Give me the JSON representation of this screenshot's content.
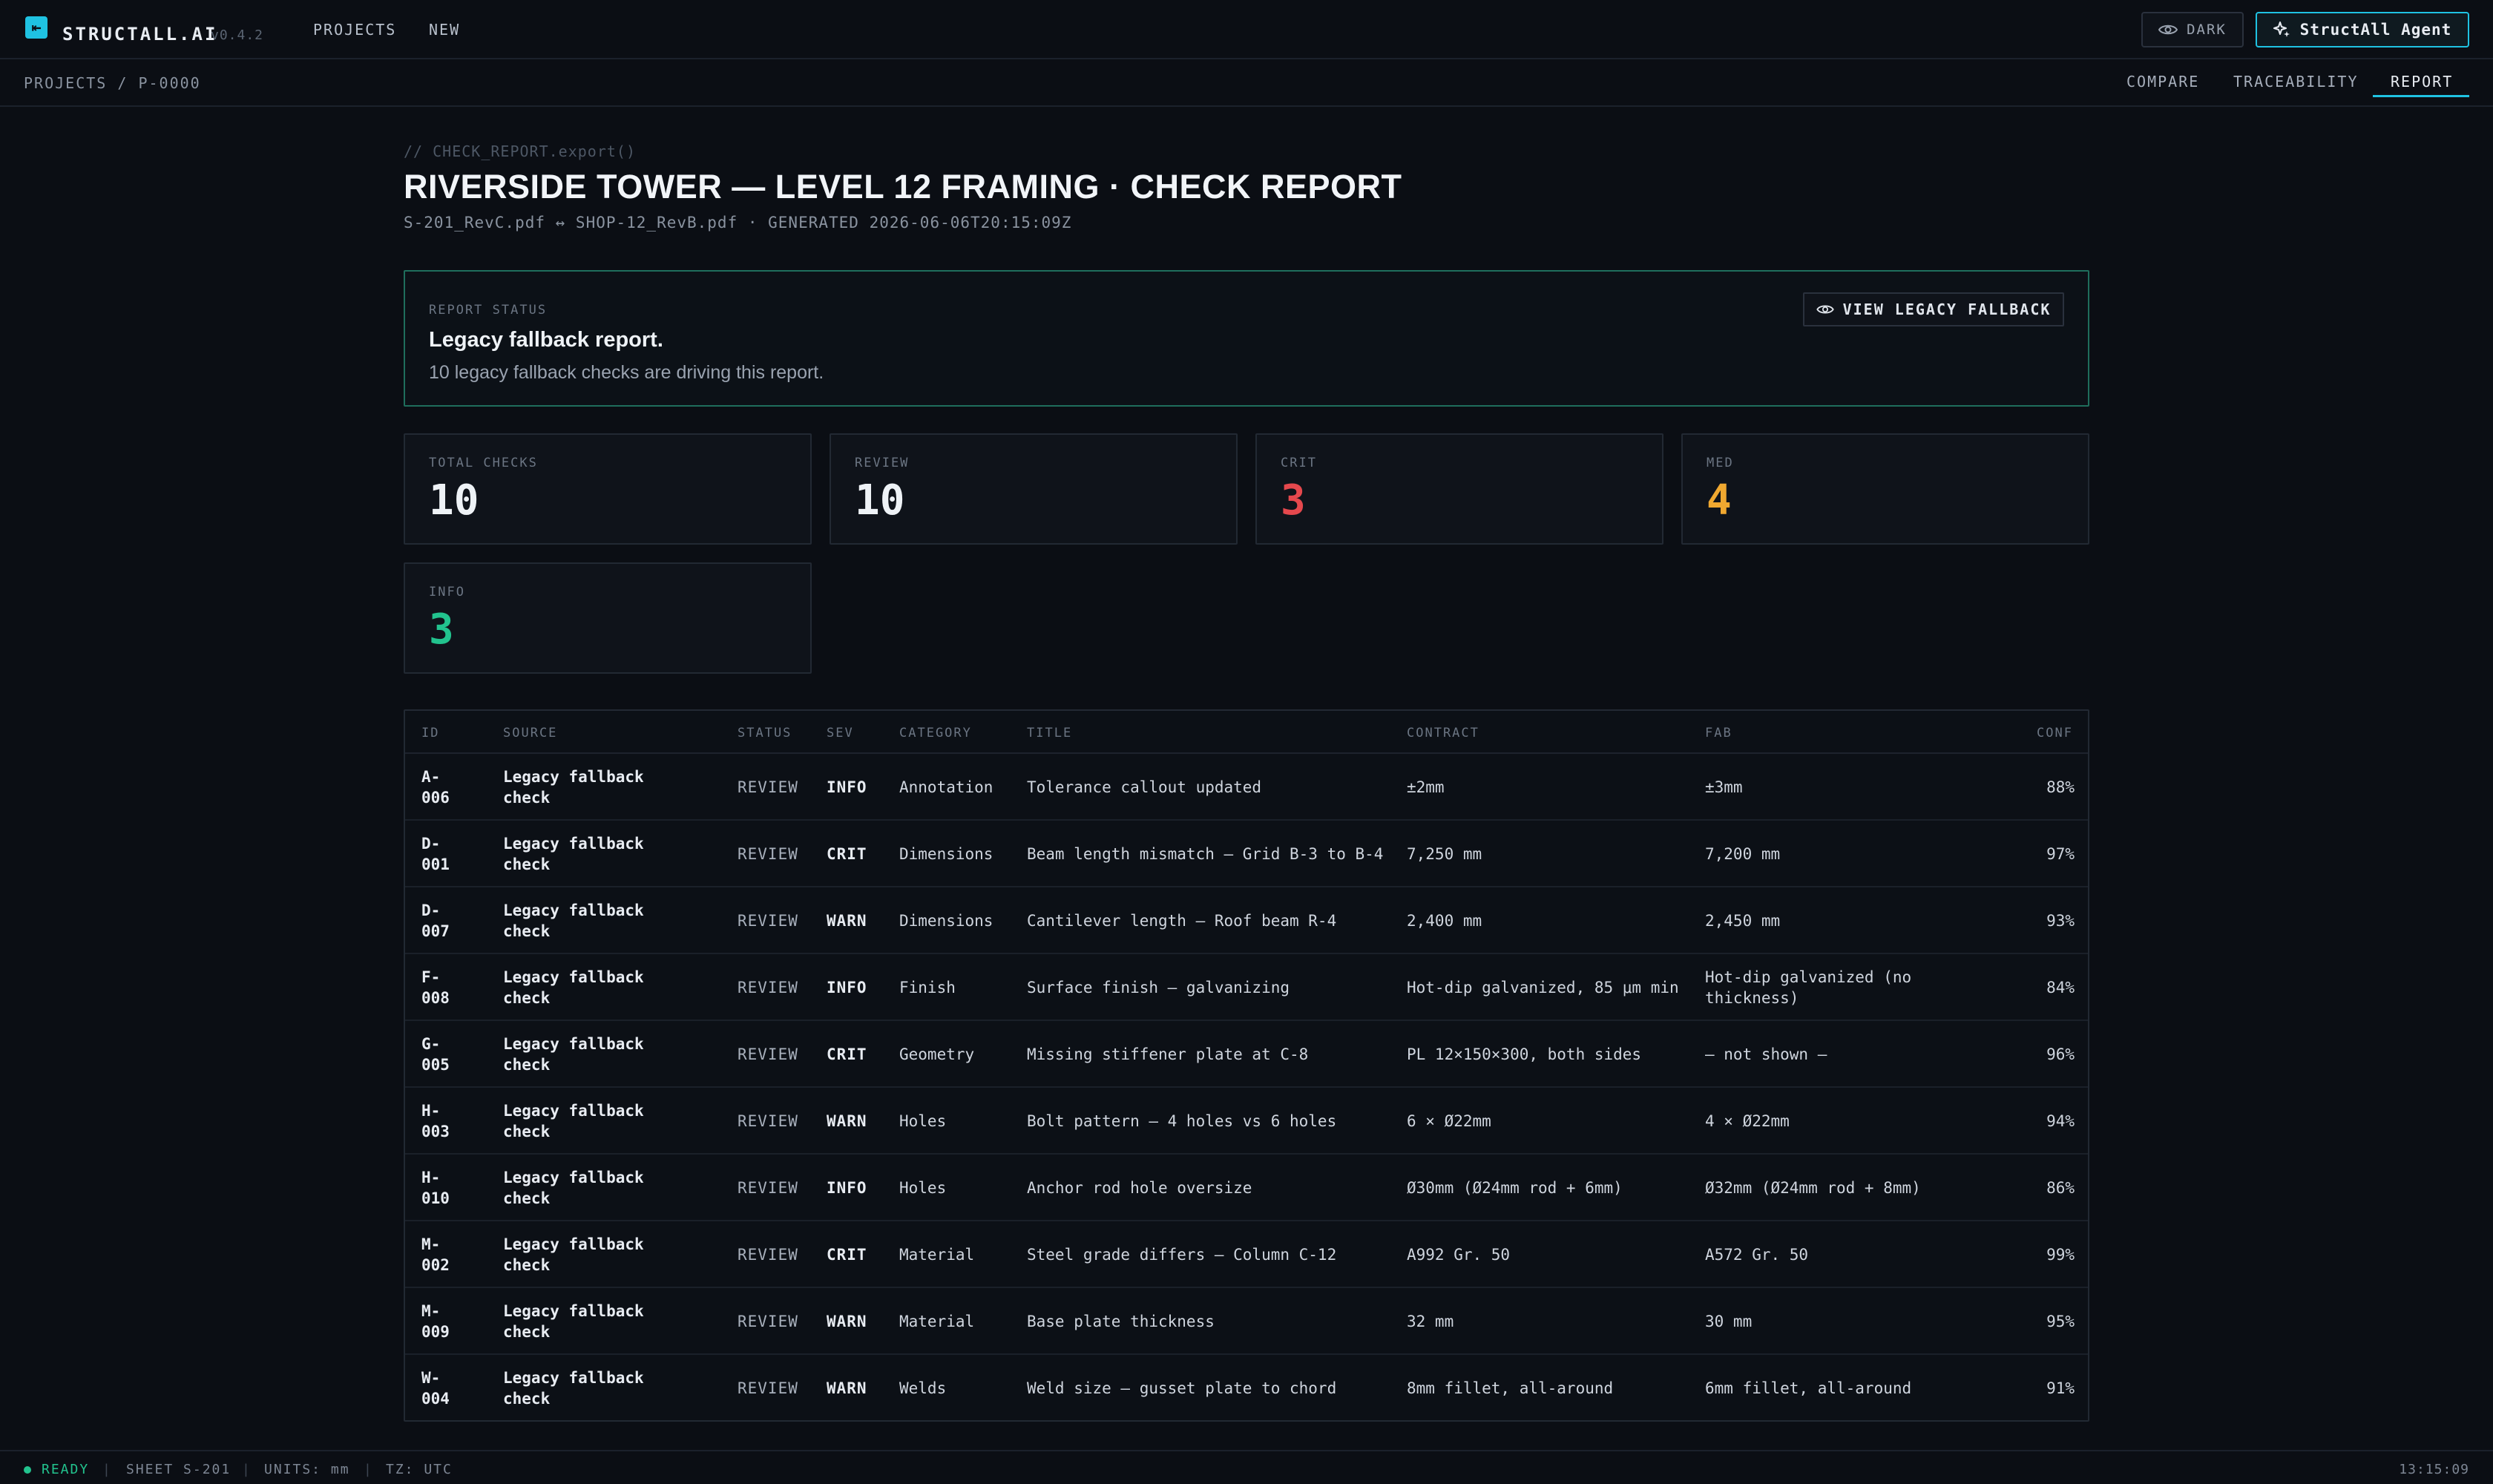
{
  "topbar": {
    "brand": "STRUCTALL.AI",
    "version": "v0.4.2",
    "nav": [
      "PROJECTS",
      "NEW"
    ],
    "theme_label": "DARK",
    "agent_label": "StructAll Agent"
  },
  "subbar": {
    "breadcrumb": "PROJECTS / P-0000",
    "tabs": [
      "COMPARE",
      "TRACEABILITY",
      "REPORT"
    ],
    "active_tab": "REPORT"
  },
  "header": {
    "comment": "// CHECK_REPORT.export()",
    "title": "RIVERSIDE TOWER — LEVEL 12 FRAMING · CHECK REPORT",
    "subtitle": "S-201_RevC.pdf ↔ SHOP-12_RevB.pdf · GENERATED 2026-06-06T20:15:09Z"
  },
  "report_status": {
    "label": "REPORT STATUS",
    "heading": "Legacy fallback report.",
    "text": "10 legacy fallback checks are driving this report.",
    "button_label": "VIEW LEGACY FALLBACK"
  },
  "kpis": [
    {
      "label": "TOTAL CHECKS",
      "value": "10",
      "color": "#eef2f6"
    },
    {
      "label": "REVIEW",
      "value": "10",
      "color": "#eef2f6"
    },
    {
      "label": "CRIT",
      "value": "3",
      "color": "#e5484d"
    },
    {
      "label": "MED",
      "value": "4",
      "color": "#f0a830"
    },
    {
      "label": "INFO",
      "value": "3",
      "color": "#22c38e"
    }
  ],
  "table": {
    "headers": [
      "ID",
      "SOURCE",
      "STATUS",
      "SEV",
      "CATEGORY",
      "TITLE",
      "CONTRACT",
      "FAB",
      "CONF"
    ],
    "rows": [
      {
        "id_a": "A-",
        "id_b": "006",
        "src_a": "Legacy fallback",
        "src_b": "check",
        "status": "REVIEW",
        "sev": "INFO",
        "category": "Annotation",
        "title": "Tolerance callout updated",
        "contract": "±2mm",
        "fab": "±3mm",
        "conf": "88%"
      },
      {
        "id_a": "D-",
        "id_b": "001",
        "src_a": "Legacy fallback",
        "src_b": "check",
        "status": "REVIEW",
        "sev": "CRIT",
        "category": "Dimensions",
        "title": "Beam length mismatch — Grid B-3 to B-4",
        "contract": "7,250 mm",
        "fab": "7,200 mm",
        "conf": "97%"
      },
      {
        "id_a": "D-",
        "id_b": "007",
        "src_a": "Legacy fallback",
        "src_b": "check",
        "status": "REVIEW",
        "sev": "WARN",
        "category": "Dimensions",
        "title": "Cantilever length — Roof beam R-4",
        "contract": "2,400 mm",
        "fab": "2,450 mm",
        "conf": "93%"
      },
      {
        "id_a": "F-",
        "id_b": "008",
        "src_a": "Legacy fallback",
        "src_b": "check",
        "status": "REVIEW",
        "sev": "INFO",
        "category": "Finish",
        "title": "Surface finish — galvanizing",
        "contract": "Hot-dip galvanized, 85 μm min",
        "fab": "Hot-dip galvanized (no thickness)",
        "conf": "84%"
      },
      {
        "id_a": "G-",
        "id_b": "005",
        "src_a": "Legacy fallback",
        "src_b": "check",
        "status": "REVIEW",
        "sev": "CRIT",
        "category": "Geometry",
        "title": "Missing stiffener plate at C-8",
        "contract": "PL 12×150×300, both sides",
        "fab": "— not shown —",
        "conf": "96%"
      },
      {
        "id_a": "H-",
        "id_b": "003",
        "src_a": "Legacy fallback",
        "src_b": "check",
        "status": "REVIEW",
        "sev": "WARN",
        "category": "Holes",
        "title": "Bolt pattern — 4 holes vs 6 holes",
        "contract": "6 × Ø22mm",
        "fab": "4 × Ø22mm",
        "conf": "94%"
      },
      {
        "id_a": "H-",
        "id_b": "010",
        "src_a": "Legacy fallback",
        "src_b": "check",
        "status": "REVIEW",
        "sev": "INFO",
        "category": "Holes",
        "title": "Anchor rod hole oversize",
        "contract": "Ø30mm (Ø24mm rod + 6mm)",
        "fab": "Ø32mm (Ø24mm rod + 8mm)",
        "conf": "86%"
      },
      {
        "id_a": "M-",
        "id_b": "002",
        "src_a": "Legacy fallback",
        "src_b": "check",
        "status": "REVIEW",
        "sev": "CRIT",
        "category": "Material",
        "title": "Steel grade differs — Column C-12",
        "contract": "A992 Gr. 50",
        "fab": "A572 Gr. 50",
        "conf": "99%"
      },
      {
        "id_a": "M-",
        "id_b": "009",
        "src_a": "Legacy fallback",
        "src_b": "check",
        "status": "REVIEW",
        "sev": "WARN",
        "category": "Material",
        "title": "Base plate thickness",
        "contract": "32 mm",
        "fab": "30 mm",
        "conf": "95%"
      },
      {
        "id_a": "W-",
        "id_b": "004",
        "src_a": "Legacy fallback",
        "src_b": "check",
        "status": "REVIEW",
        "sev": "WARN",
        "category": "Welds",
        "title": "Weld size — gusset plate to chord",
        "contract": "8mm fillet, all-around",
        "fab": "6mm fillet, all-around",
        "conf": "91%"
      }
    ]
  },
  "statusbar": {
    "ready": "READY",
    "sheet": "SHEET S-201",
    "units": "UNITS: mm",
    "tz": "TZ: UTC",
    "time": "13:15:09"
  },
  "colors": {
    "accent": "#1fc2e2",
    "status_border": "#1f6e5c",
    "ok": "#22c38e"
  }
}
